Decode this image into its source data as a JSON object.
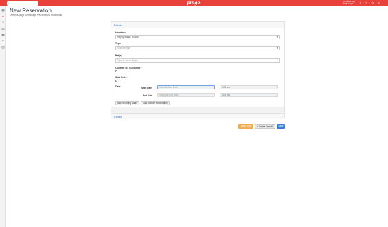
{
  "topbar": {
    "search_placeholder": "",
    "brand": "pingo",
    "user_line1": "Hi Team Pingo",
    "user_line2": "Pingo Pingo",
    "icons": [
      "bell-icon",
      "help-icon",
      "chat-icon",
      "user-icon"
    ],
    "brand_color": "#e8413c"
  },
  "sidebar": {
    "items": [
      {
        "icon": "calendar-icon",
        "active": false
      },
      {
        "icon": "circle-icon",
        "active": true
      },
      {
        "icon": "list-icon",
        "active": false
      },
      {
        "icon": "grid-icon",
        "active": false
      },
      {
        "icon": "inbox-icon",
        "active": false
      },
      {
        "icon": "heart-icon",
        "active": false
      },
      {
        "icon": "table-icon",
        "active": false
      }
    ]
  },
  "page": {
    "title": "New Reservation",
    "subtitle": "Use this page to manage reservations for animals"
  },
  "panel": {
    "details_label": "Details",
    "extras_label": "Extras",
    "location": {
      "label": "Location",
      "value": "Happy Wags - Boulder"
    },
    "type": {
      "label": "Type",
      "placeholder": "Select a Type"
    },
    "pet": {
      "label": "Pet(s)",
      "placeholder": "Type to Select Pet(s)"
    },
    "confirm": {
      "label": "Confirm for Customer?"
    },
    "waitlist": {
      "label": "Wait List?"
    },
    "date": {
      "label": "Date",
      "start_label": "Start Date",
      "end_label": "End Date",
      "start_placeholder": "Select a Start Date",
      "end_placeholder": "Select an End Date",
      "start_time": "6:00 am",
      "end_time": "6:00 pm"
    },
    "add_recurring": "Add Recurring Dates",
    "add_another": "Add Another Reservation"
  },
  "footer_buttons": {
    "draft": "Save Draft",
    "deposit": "+ Create Deposit",
    "save": "Save",
    "draft_color": "#f0ad4e",
    "save_color": "#3b7dd8"
  }
}
